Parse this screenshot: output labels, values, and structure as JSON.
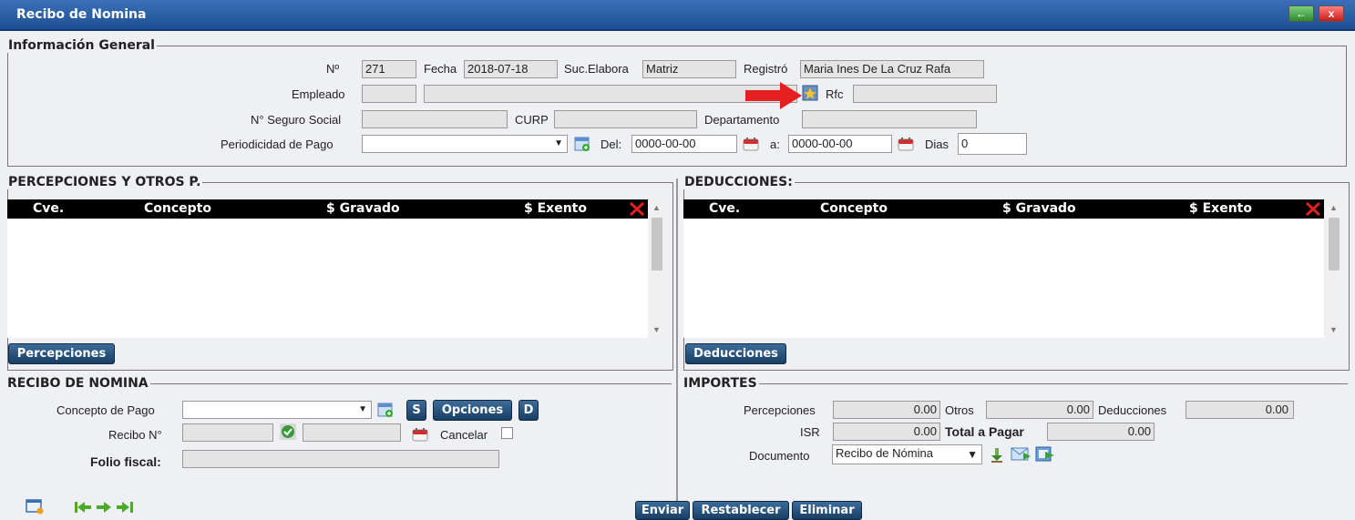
{
  "window": {
    "title": "Recibo de Nomina",
    "back_icon": "←",
    "close_icon": "x"
  },
  "general": {
    "legend": "Información General",
    "no_label": "Nº",
    "no_value": "271",
    "fecha_label": "Fecha",
    "fecha_value": "2018-07-18",
    "suc_label": "Suc.Elabora",
    "suc_value": "Matriz",
    "registro_label": "Registró",
    "registro_value": "Maria Ines De La Cruz Rafa",
    "empleado_label": "Empleado",
    "rfc_label": "Rfc",
    "seguro_label": "N° Seguro Social",
    "curp_label": "CURP",
    "departamento_label": "Departamento",
    "periodicidad_label": "Periodicidad de Pago",
    "periodicidad_value": "",
    "del_label": "Del:",
    "del_value": "0000-00-00",
    "a_label": "a:",
    "a_value": "0000-00-00",
    "dias_label": "Dias",
    "dias_value": "0"
  },
  "percepciones": {
    "legend": "PERCEPCIONES Y OTROS P.",
    "columns": [
      "Cve.",
      "Concepto",
      "$ Gravado",
      "$ Exento"
    ],
    "button": "Percepciones"
  },
  "deducciones": {
    "legend": "DEDUCCIONES:",
    "columns": [
      "Cve.",
      "Concepto",
      "$ Gravado",
      "$ Exento"
    ],
    "button": "Deducciones"
  },
  "recibo": {
    "legend": "RECIBO DE NOMINA",
    "concepto_label": "Concepto de Pago",
    "recibo_label": "Recibo N°",
    "cancelar_label": "Cancelar",
    "folio_label": "Folio fiscal:",
    "s_button": "S",
    "opciones_button": "Opciones",
    "d_button": "D"
  },
  "importes": {
    "legend": "IMPORTES",
    "percepciones_label": "Percepciones",
    "percepciones_value": "0.00",
    "otros_label": "Otros",
    "otros_value": "0.00",
    "deducciones_label": "Deducciones",
    "deducciones_value": "0.00",
    "isr_label": "ISR",
    "isr_value": "0.00",
    "total_label": "Total a Pagar",
    "total_value": "0.00",
    "documento_label": "Documento",
    "documento_value": "Recibo de Nómina"
  },
  "footer": {
    "enviar": "Enviar",
    "restablecer": "Restablecer",
    "eliminar": "Eliminar"
  },
  "colors": {
    "titlebar": "#1f4f94",
    "button": "#183e63",
    "grid_header": "#000000",
    "delete_x": "#e02020"
  }
}
